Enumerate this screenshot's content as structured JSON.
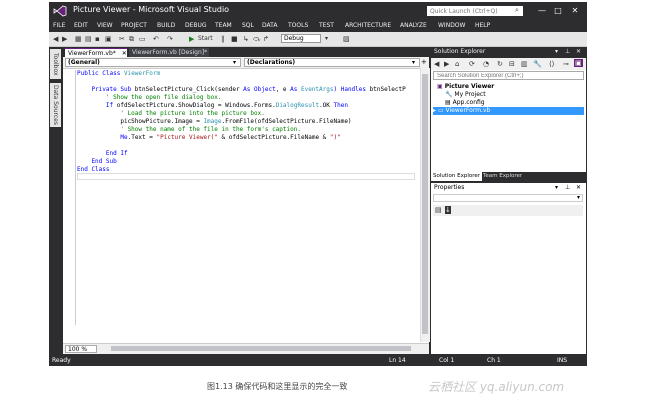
{
  "window": {
    "title": "Picture Viewer - Microsoft Visual Studio",
    "quick_launch_placeholder": "Quick Launch (Ctrl+Q)",
    "minimize": "—",
    "restore": "□",
    "close": "✕"
  },
  "menu": [
    "FILE",
    "EDIT",
    "VIEW",
    "PROJECT",
    "BUILD",
    "DEBUG",
    "TEAM",
    "SQL",
    "DATA",
    "TOOLS",
    "TEST",
    "ARCHITECTURE",
    "ANALYZE",
    "WINDOW",
    "HELP"
  ],
  "toolbar": {
    "start_label": "Start",
    "config": "Debug"
  },
  "left_tabs": [
    "Toolbox",
    "Data Sources"
  ],
  "editor": {
    "tabs": [
      {
        "label": "ViewerForm.vb*",
        "close": "✕"
      },
      {
        "label": "ViewerForm.vb [Design]*"
      }
    ],
    "nav_left": "(General)",
    "nav_right": "(Declarations)",
    "lines": [
      "Public Class ViewerForm",
      "",
      "    Private Sub btnSelectPicture_Click(sender As Object, e As EventArgs) Handles btnSelectP",
      "        ' Show the open file dialog box.",
      "        If ofdSelectPicture.ShowDialog = Windows.Forms.DialogResult.OK Then",
      "            ' Load the picture into the picture box.",
      "            picShowPicture.Image = Image.FromFile(ofdSelectPicture.FileName)",
      "            ' Show the name of the file in the form's caption.",
      "            Me.Text = \"Picture Viewer(\" & ofdSelectPicture.FileName & \")\"",
      "",
      "        End If",
      "    End Sub",
      "End Class"
    ],
    "zoom": "100 %"
  },
  "solution_explorer": {
    "title": "Solution Explorer",
    "search_placeholder": "Search Solution Explorer (Ctrl+;)",
    "items": [
      {
        "label": "Picture Viewer"
      },
      {
        "label": "My Project"
      },
      {
        "label": "App.config"
      },
      {
        "label": "ViewerForm.vb"
      }
    ],
    "tabs": [
      "Solution Explorer",
      "Team Explorer"
    ]
  },
  "properties": {
    "title": "Properties"
  },
  "status": {
    "ready": "Ready",
    "ln": "Ln 14",
    "col": "Col 1",
    "ch": "Ch 1",
    "ins": "INS"
  },
  "caption": "图1.13    确保代码和这里显示的完全一致",
  "watermark": "云栖社区 yq.aliyun.com",
  "colors": {
    "chrome": "#2d2d30",
    "accent": "#68217a",
    "selection": "#3399ff",
    "keyword": "#0000ff",
    "comment": "#008000",
    "string": "#a31515"
  }
}
